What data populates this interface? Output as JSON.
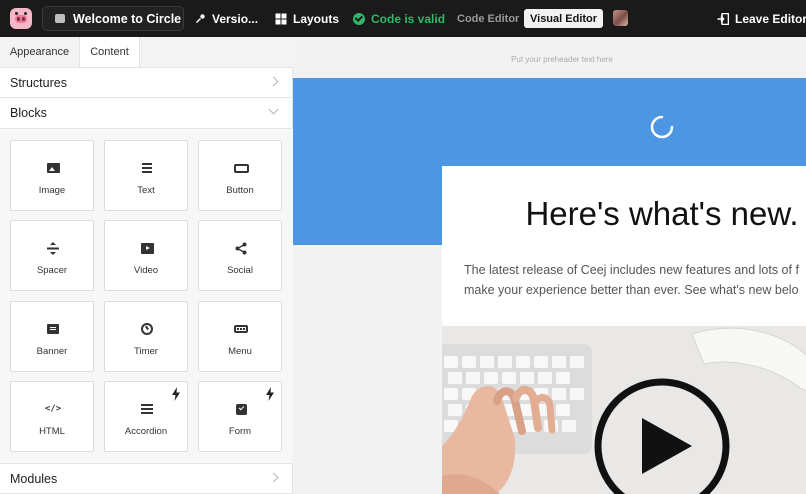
{
  "topbar": {
    "doc_title": "Welcome to Circle",
    "versions_label": "Versio...",
    "layouts_label": "Layouts",
    "status_label": "Code is valid",
    "code_editor_label": "Code Editor",
    "visual_editor_label": "Visual Editor",
    "leave_label": "Leave Editor",
    "status_color": "#2fb868"
  },
  "panel": {
    "tabs": [
      {
        "label": "Appearance",
        "active": false
      },
      {
        "label": "Content",
        "active": true
      }
    ],
    "sections": {
      "structures": "Structures",
      "blocks": "Blocks",
      "modules": "Modules"
    },
    "blocks": [
      {
        "label": "Image",
        "icon": "image-icon"
      },
      {
        "label": "Text",
        "icon": "text-icon"
      },
      {
        "label": "Button",
        "icon": "button-icon"
      },
      {
        "label": "Spacer",
        "icon": "spacer-icon"
      },
      {
        "label": "Video",
        "icon": "video-icon"
      },
      {
        "label": "Social",
        "icon": "share-icon"
      },
      {
        "label": "Banner",
        "icon": "banner-icon"
      },
      {
        "label": "Timer",
        "icon": "timer-icon"
      },
      {
        "label": "Menu",
        "icon": "menu-icon"
      },
      {
        "label": "HTML",
        "icon": "code-icon",
        "glyph": "</>"
      },
      {
        "label": "Accordion",
        "icon": "accordion-icon",
        "premium": true
      },
      {
        "label": "Form",
        "icon": "form-icon",
        "premium": true
      }
    ]
  },
  "email": {
    "preheader": "Put your preheader text here",
    "headline": "Here's what's new.",
    "body_line1": "The latest release of Ceej includes new features and lots of f",
    "body_line2": "make your experience better than ever. See what's new belo",
    "hero_color": "#4d97e2"
  }
}
